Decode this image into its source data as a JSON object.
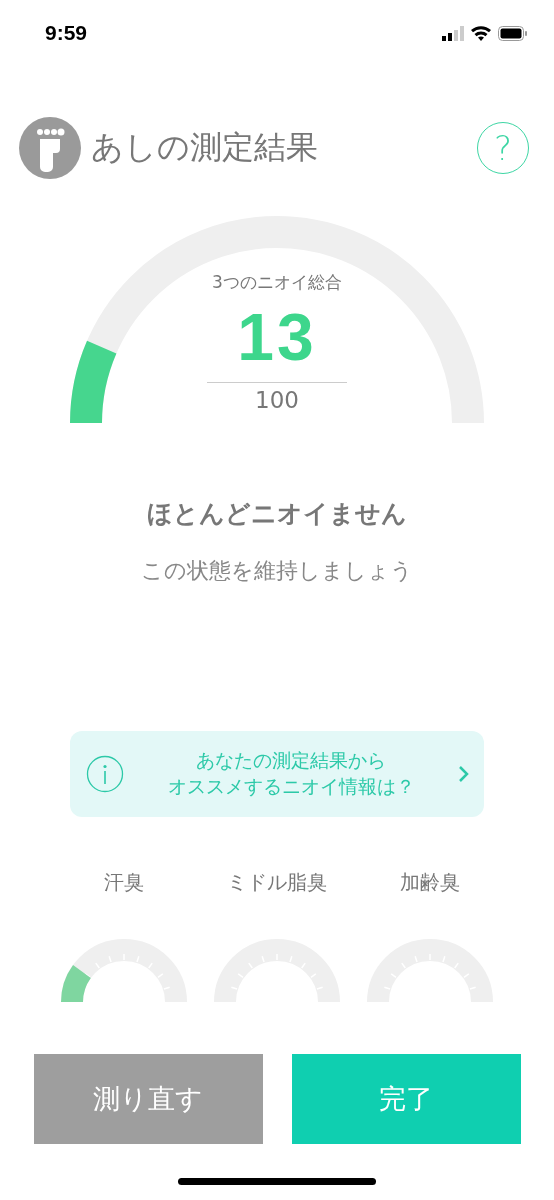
{
  "status_bar": {
    "time": "9:59"
  },
  "header": {
    "title": "あしの測定結果",
    "help": "?"
  },
  "total": {
    "label": "3つのニオイ総合",
    "score": "13",
    "max": "100"
  },
  "message": {
    "title": "ほとんどニオイません",
    "subtitle": "この状態を維持しましょう"
  },
  "info_card": {
    "lines": [
      "あなたの測定結果から",
      "オススメするニオイ情報は？"
    ]
  },
  "categories": [
    {
      "name": "汗臭"
    },
    {
      "name": "ミドル脂臭"
    },
    {
      "name": "加齢臭"
    }
  ],
  "buttons": [
    {
      "label": "測り直す",
      "kind": "secondary"
    },
    {
      "label": "完了",
      "kind": "primary"
    }
  ]
}
